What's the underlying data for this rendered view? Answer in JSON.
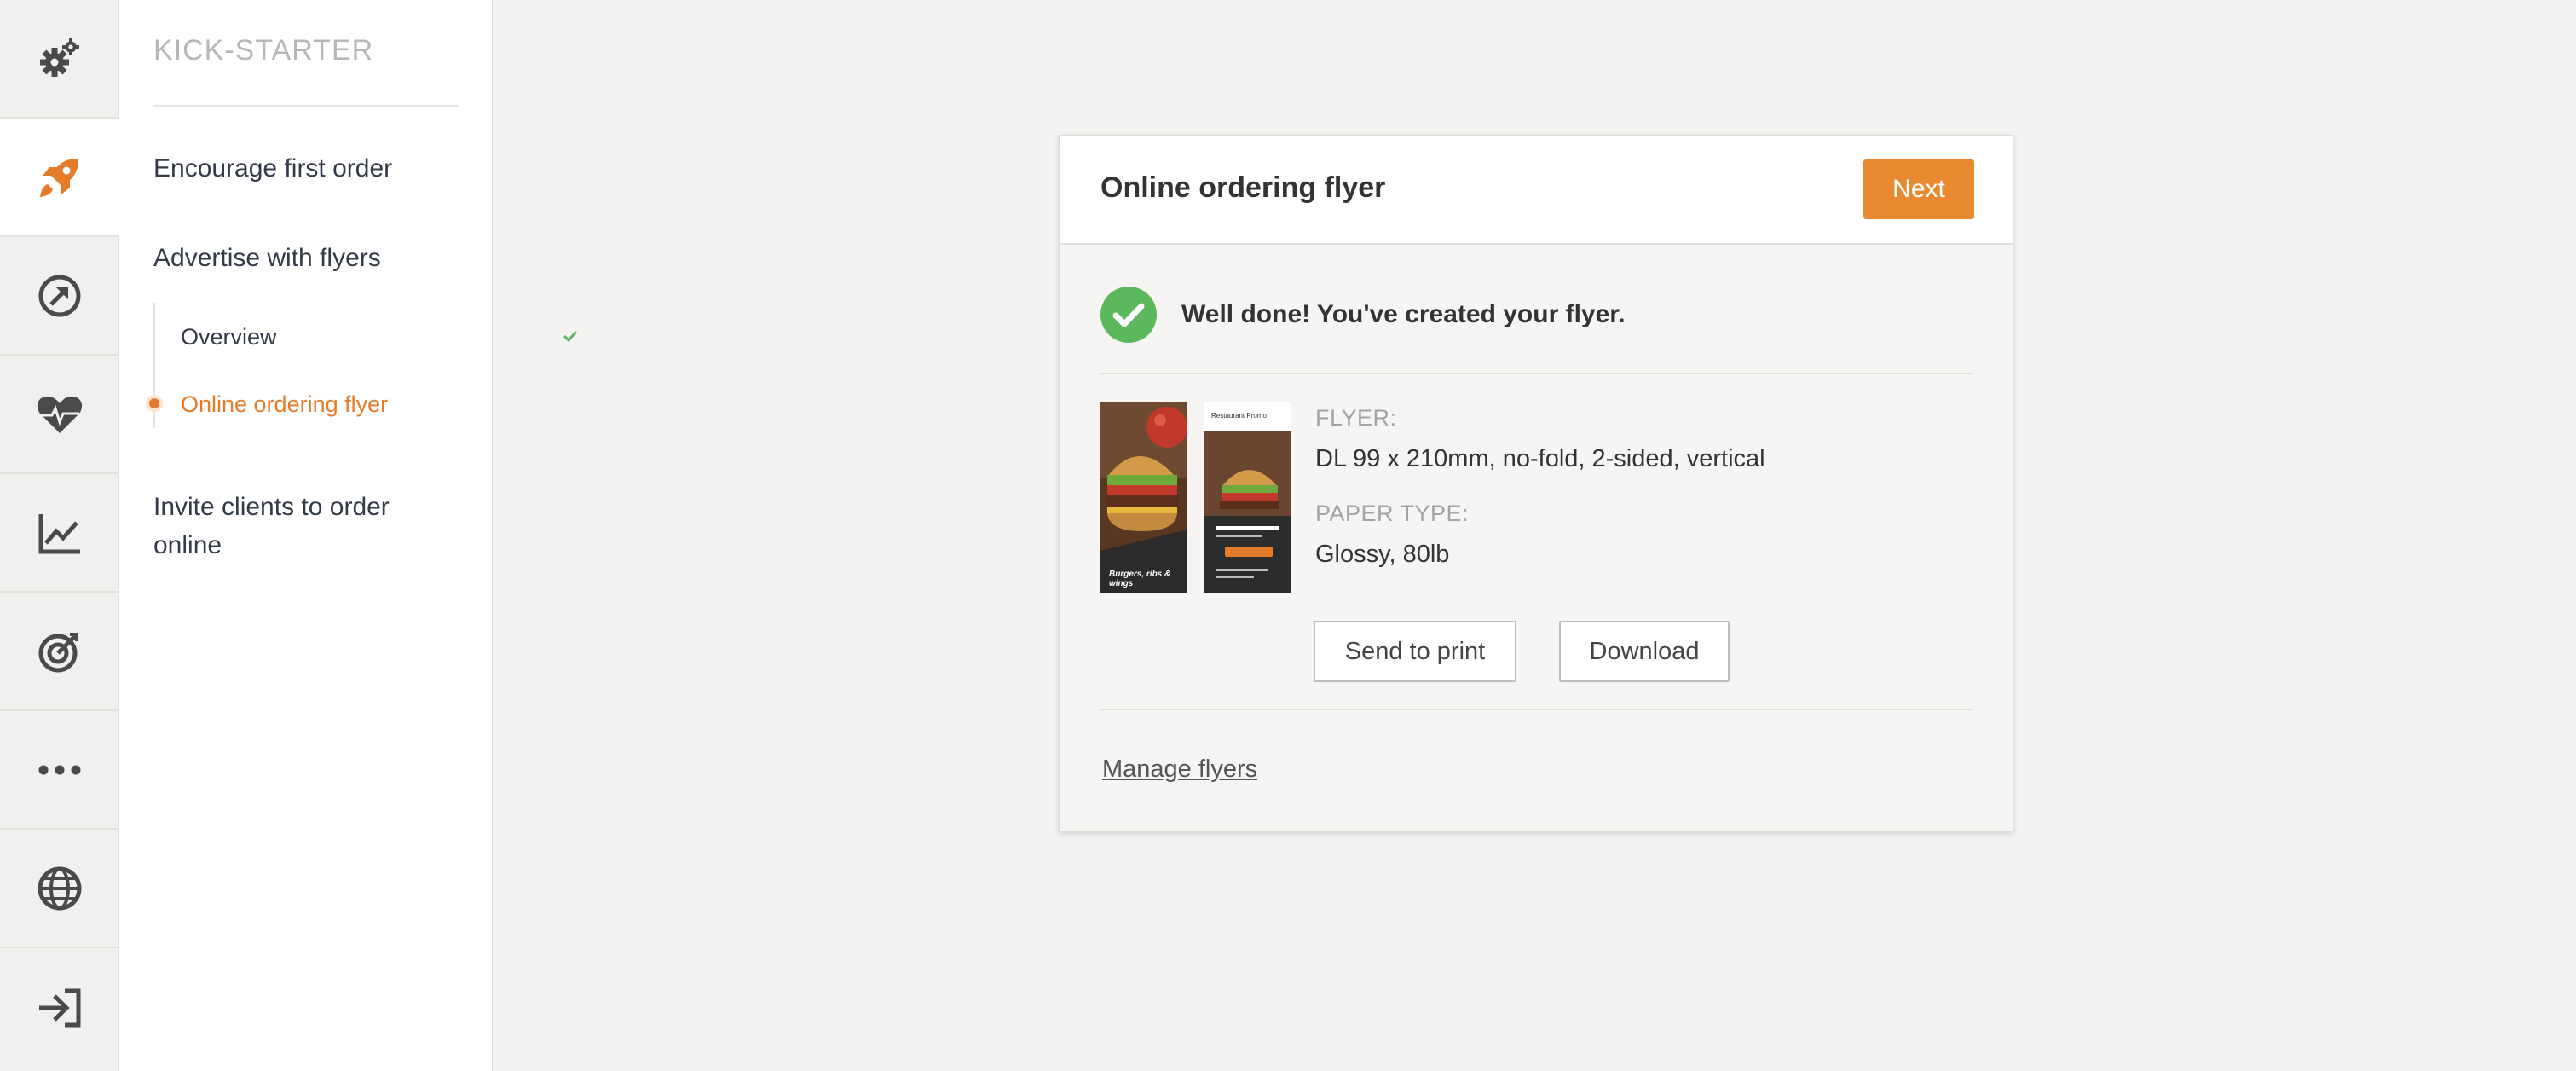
{
  "rail": {
    "items": [
      {
        "icon": "gears-icon",
        "active": false
      },
      {
        "icon": "rocket-icon",
        "active": true
      },
      {
        "icon": "compass-arrow-icon",
        "active": false
      },
      {
        "icon": "heartbeat-icon",
        "active": false
      },
      {
        "icon": "line-chart-icon",
        "active": false
      },
      {
        "icon": "target-icon",
        "active": false
      },
      {
        "icon": "more-icon",
        "active": false
      },
      {
        "icon": "globe-icon",
        "active": false
      },
      {
        "icon": "sign-in-icon",
        "active": false
      }
    ],
    "accent_color": "#e57c2b"
  },
  "sidebar": {
    "title": "KICK-STARTER",
    "items": [
      {
        "label": "Encourage first order"
      },
      {
        "label": "Advertise with flyers"
      },
      {
        "label": "Invite clients to order online"
      }
    ],
    "subitems": [
      {
        "label": "Overview",
        "completed": true
      },
      {
        "label": "Online ordering flyer",
        "active": true
      }
    ]
  },
  "card": {
    "title": "Online ordering flyer",
    "next_label": "Next",
    "success_message": "Well done! You've created your flyer.",
    "flyer_label": "FLYER:",
    "flyer_value": "DL 99 x 210mm, no-fold, 2-sided, vertical",
    "paper_label": "PAPER TYPE:",
    "paper_value": "Glossy, 80lb",
    "send_label": "Send to print",
    "download_label": "Download",
    "manage_label": "Manage flyers",
    "thumbnails": {
      "front_caption": "Burgers, ribs & wings",
      "back_heading": "Restaurant Promo"
    }
  },
  "colors": {
    "accent": "#ea8a30",
    "success": "#5cb85c",
    "page_bg": "#f4f3f1"
  }
}
